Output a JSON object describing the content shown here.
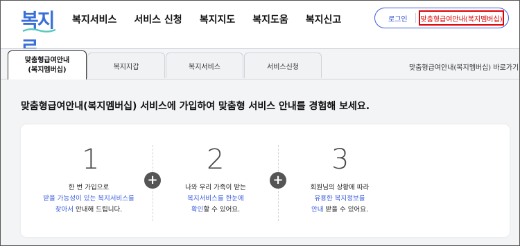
{
  "header": {
    "logo": "복지로",
    "nav": [
      "복지서비스",
      "서비스 신청",
      "복지지도",
      "복지도움",
      "복지신고"
    ],
    "login_label": "로그인",
    "member_label": "맞춤형급여안내(복지멤버십)"
  },
  "tabs": {
    "items": [
      {
        "label_line1": "맞춤형급여안내",
        "label_line2": "(복지멤버십)",
        "active": true
      },
      {
        "label": "복지지갑"
      },
      {
        "label": "복지서비스"
      },
      {
        "label": "서비스신청"
      }
    ],
    "shortcut_label": "맞춤형급여안내(복지멤버십) 바로가기"
  },
  "main": {
    "headline": "맞춤형급여안내(복지멤버십) 서비스에 가입하여 맞춤형 서비스 안내를 경험해 보세요.",
    "steps": [
      {
        "number": "1",
        "line1": "한 번 가입으로",
        "line2_hl": "받을 가능성이 있는 복지서비스를",
        "line3_hl": "찾아서",
        "line3_rest": " 안내해 드립니다."
      },
      {
        "number": "2",
        "line1": "나와 우리 가족이 받는",
        "line2_hl": "복지서비스를 한눈에",
        "line3_hl": "확인",
        "line3_rest": "할 수 있어요."
      },
      {
        "number": "3",
        "line1": "회원님의 상황에 따라",
        "line2_hl": "유용한 복지정보를",
        "line3_hl": "안내",
        "line3_rest": " 받을 수 있어요."
      }
    ],
    "plus_symbol": "+"
  },
  "colors": {
    "accent": "#3b5bdb",
    "highlight_border": "#e00000",
    "logo": "#3a6fd8"
  }
}
